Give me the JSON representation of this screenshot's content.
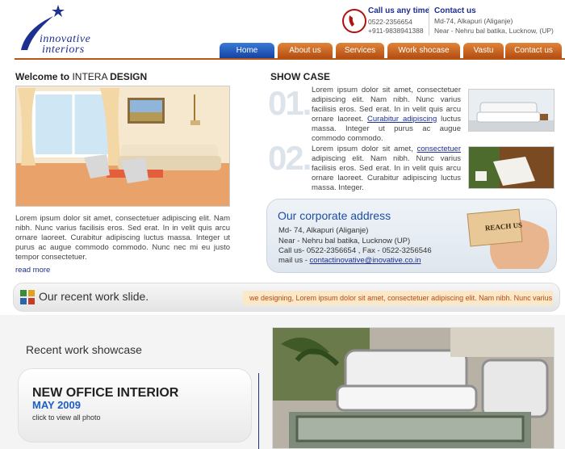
{
  "header": {
    "logo_line1": "innovative",
    "logo_line2": "interiors",
    "call_title": "Call us any time",
    "call_phone1": "0522-2356654",
    "call_phone2": "+911-9838941388",
    "contact_title": "Contact us",
    "contact_line1": "Md-74, Alkapuri (Aliganje)",
    "contact_line2": "Near -  Nehru bal batika, Lucknow, (UP)"
  },
  "nav": {
    "items": [
      {
        "label": "Home"
      },
      {
        "label": "About us"
      },
      {
        "label": "Services"
      },
      {
        "label": "Work shocase"
      },
      {
        "label": "Vastu"
      },
      {
        "label": "Contact us"
      }
    ],
    "active_color": "#1f52b8",
    "tab_color": "#c9621c"
  },
  "welcome": {
    "title_bold": "Welcome to",
    "title_thin": " INTERA ",
    "title_bold2": " DESIGN",
    "text": "Lorem ipsum dolor sit amet, consectetuer adipiscing elit. Nam nibh. Nunc varius facilisis eros. Sed erat. In in velit quis arcu ornare laoreet. Curabitur adipiscing luctus massa. Integer ut purus ac augue commodo commodo. Nunc nec mi eu justo tempor consectetuer.",
    "read_more": "read more"
  },
  "showcase": {
    "title": "SHOW CASE",
    "items": [
      {
        "number": "01.",
        "text_a": "Lorem ipsum dolor sit amet, consectetuer adipiscing elit. Nam nibh. Nunc varius facilisis eros. Sed erat. In in velit quis arcu ornare laoreet. ",
        "link": "Curabitur adipiscing",
        "text_b": " luctus massa. Integer ut purus ac augue commodo commodo."
      },
      {
        "number": "02.",
        "text_a": "Lorem ipsum dolor sit amet, ",
        "link": "consectetuer",
        "text_b": " adipiscing elit. Nam nibh. Nunc varius facilisis eros. Sed erat. In in velit quis arcu ornare laoreet. Curabitur adipiscing luctus massa. Integer."
      }
    ]
  },
  "address": {
    "title": "Our corporate address",
    "line1": "Md- 74, Alkapuri (Aliganje)",
    "line2": "Near - Nehru bal batika,   Lucknow (UP)",
    "line3": "Call us-  0522-2356654 , Fax - 0522-3256546",
    "mail_label": "mail us - ",
    "mail": "contactinovative@inovative.co.in",
    "reach_label": "REACH US"
  },
  "recent_slide": {
    "title": "Our recent work slide.",
    "ticker": "we designing, Lorem ipsum dolor sit amet, consectetuer adipiscing elit. Nam nibh. Nunc varius facilis"
  },
  "recent_showcase": {
    "title": "Recent work showcase",
    "project": "NEW OFFICE INTERIOR",
    "date": "MAY 2009",
    "link": "click to view all photo"
  }
}
